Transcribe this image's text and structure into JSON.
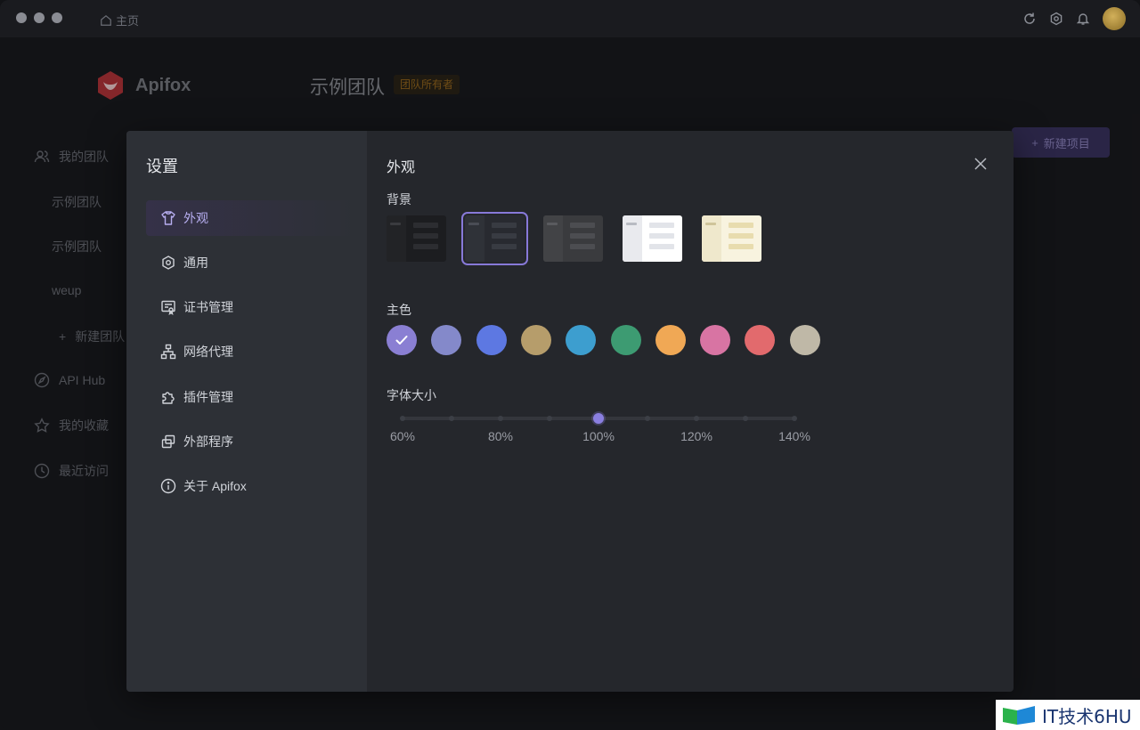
{
  "titlebar": {
    "home_label": "主页"
  },
  "app": {
    "logo_text": "Apifox",
    "team_title": "示例团队",
    "team_badge": "团队所有者",
    "new_project": "新建项目",
    "sidebar": [
      {
        "label": "我的团队",
        "icon": "users-icon"
      },
      {
        "label": "示例团队"
      },
      {
        "label": "示例团队"
      },
      {
        "label": "weup"
      },
      {
        "label": "新建团队",
        "icon": "plus-icon"
      },
      {
        "label": "API Hub",
        "icon": "compass-icon"
      },
      {
        "label": "我的收藏",
        "icon": "star-icon"
      },
      {
        "label": "最近访问",
        "icon": "clock-icon"
      }
    ]
  },
  "settings": {
    "title": "设置",
    "nav": [
      {
        "label": "外观",
        "icon": "shirt-icon",
        "active": true
      },
      {
        "label": "通用",
        "icon": "settings-icon"
      },
      {
        "label": "证书管理",
        "icon": "certificate-icon"
      },
      {
        "label": "网络代理",
        "icon": "network-icon"
      },
      {
        "label": "插件管理",
        "icon": "puzzle-icon"
      },
      {
        "label": "外部程序",
        "icon": "windows-icon"
      },
      {
        "label": "关于 Apifox",
        "icon": "info-icon"
      }
    ],
    "section_title": "外观",
    "background_label": "背景",
    "backgrounds": [
      {
        "id": "black",
        "selected": false
      },
      {
        "id": "dark",
        "selected": true
      },
      {
        "id": "gray",
        "selected": false
      },
      {
        "id": "light",
        "selected": false
      },
      {
        "id": "paper",
        "selected": false
      }
    ],
    "primary_color_label": "主色",
    "colors": [
      "#8a7fd3",
      "#8489ca",
      "#5d78e2",
      "#b69d6b",
      "#3d9ecf",
      "#3d9b72",
      "#f0a855",
      "#d874a3",
      "#e26a6d",
      "#bfb8a7"
    ],
    "selected_color_index": 0,
    "font_size_label": "字体大小",
    "font_sizes": [
      "60%",
      "80%",
      "100%",
      "120%",
      "140%"
    ],
    "font_size_value": "100%"
  },
  "watermark": {
    "text": "IT技术6HU"
  }
}
